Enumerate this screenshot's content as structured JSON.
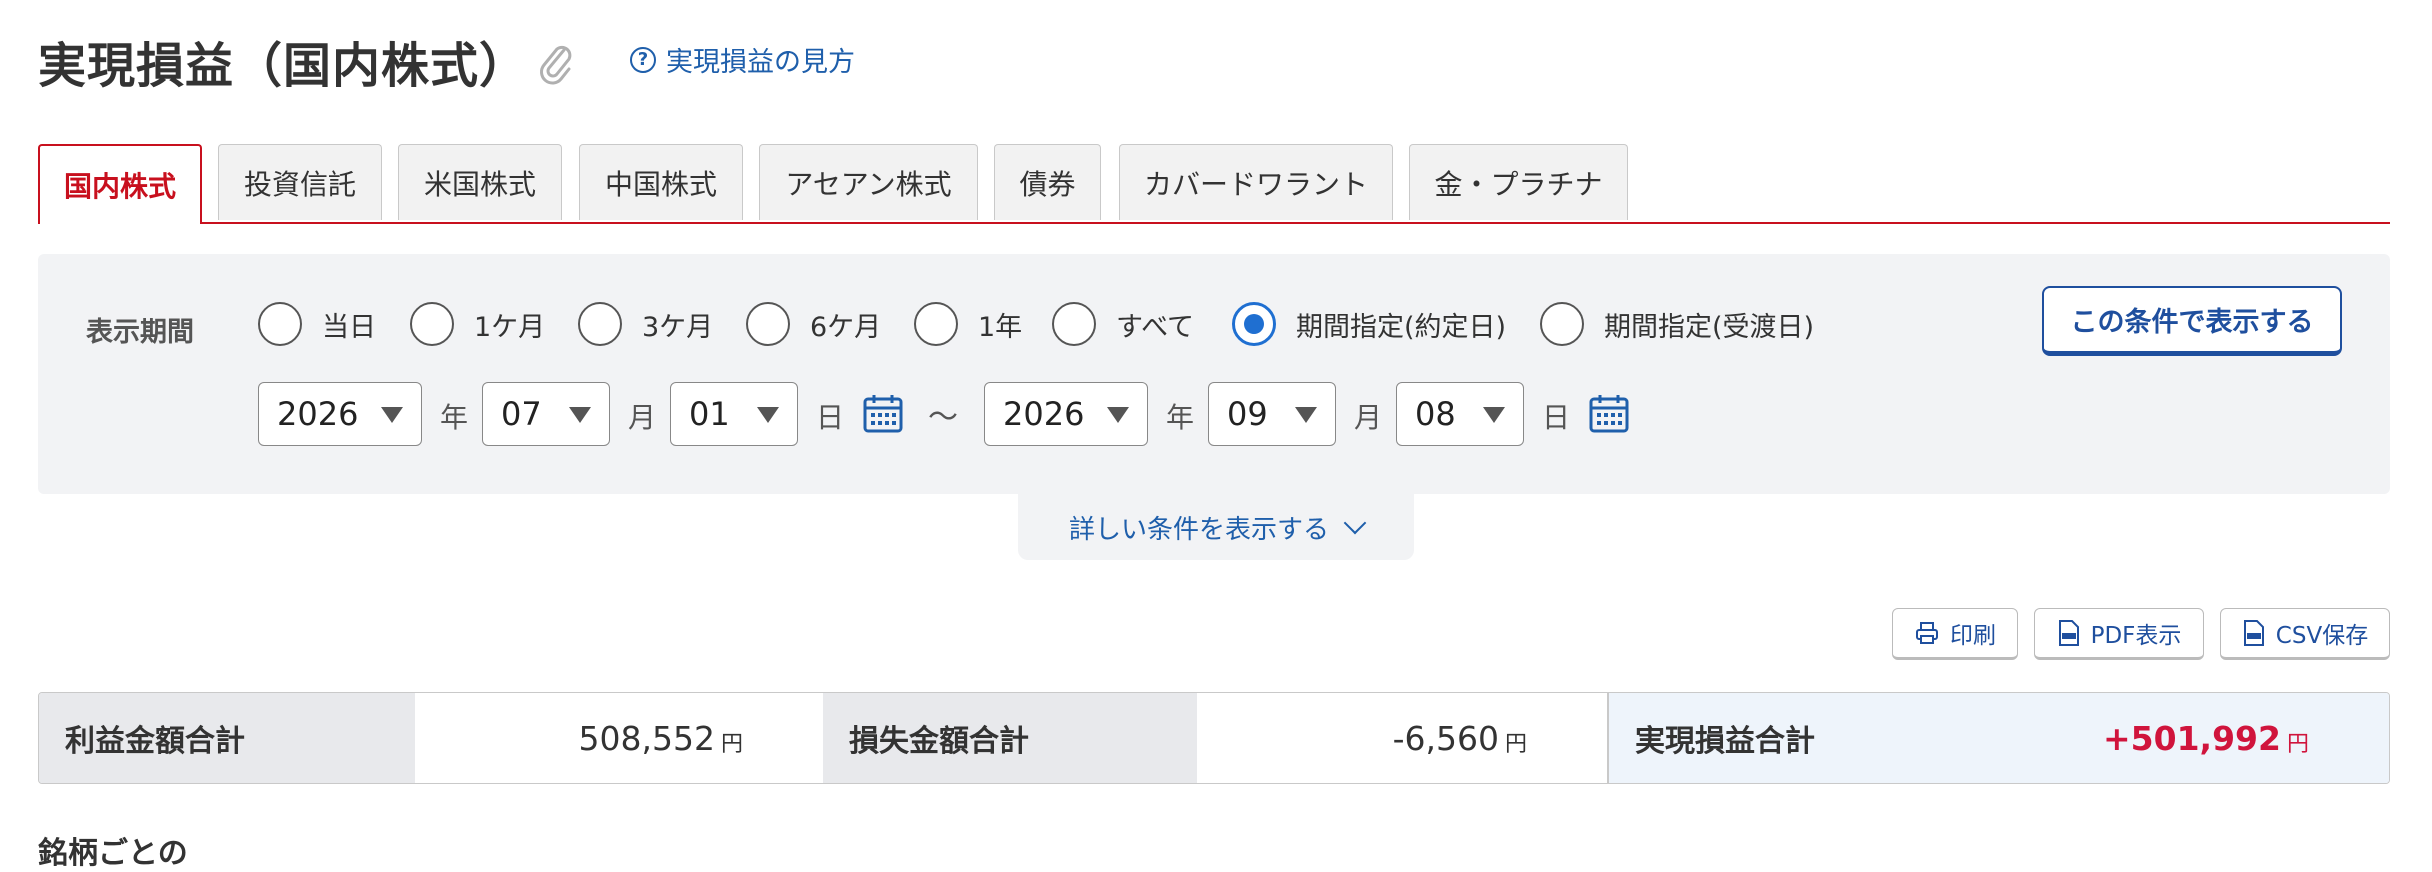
{
  "header": {
    "title": "実現損益（国内株式）",
    "help_link": "実現損益の見方",
    "help_icon_glyph": "?"
  },
  "tabs": [
    {
      "label": "国内株式",
      "active": true
    },
    {
      "label": "投資信託",
      "active": false
    },
    {
      "label": "米国株式",
      "active": false
    },
    {
      "label": "中国株式",
      "active": false
    },
    {
      "label": "アセアン株式",
      "active": false
    },
    {
      "label": "債券",
      "active": false
    },
    {
      "label": "カバードワラント",
      "active": false
    },
    {
      "label": "金・プラチナ",
      "active": false
    }
  ],
  "filter": {
    "period_label": "表示期間",
    "radios": [
      {
        "label": "当日",
        "checked": false
      },
      {
        "label": "1ケ月",
        "checked": false
      },
      {
        "label": "3ケ月",
        "checked": false
      },
      {
        "label": "6ケ月",
        "checked": false
      },
      {
        "label": "1年",
        "checked": false
      },
      {
        "label": "すべて",
        "checked": false
      },
      {
        "label": "期間指定(約定日)",
        "checked": true
      },
      {
        "label": "期間指定(受渡日)",
        "checked": false
      }
    ],
    "submit_label": "この条件で表示する",
    "from": {
      "year": "2026",
      "month": "07",
      "day": "01"
    },
    "to": {
      "year": "2026",
      "month": "09",
      "day": "08"
    },
    "unit_year": "年",
    "unit_month": "月",
    "unit_day": "日",
    "range_separator": "〜",
    "more_conditions": "詳しい条件を表示する"
  },
  "actions": {
    "print": "印刷",
    "pdf": "PDF表示",
    "csv": "CSV保存"
  },
  "summary": {
    "profit_label": "利益金額合計",
    "profit_value": "508,552",
    "loss_label": "損失金額合計",
    "loss_value": "-6,560",
    "total_label": "実現損益合計",
    "total_value": "+501,992",
    "yen": "円"
  },
  "colors": {
    "accent_red": "#c8101e",
    "link_blue": "#1f5fab",
    "radio_blue": "#1f6fd1",
    "total_red": "#d0143c"
  },
  "icons": {
    "clip": "paperclip-icon",
    "help": "question-circle-icon",
    "calendar": "calendar-icon",
    "chevron": "chevron-down-icon",
    "print": "printer-icon",
    "pdf": "pdf-file-icon",
    "csv": "csv-file-icon"
  },
  "partial_heading": "銘柄ごとの"
}
